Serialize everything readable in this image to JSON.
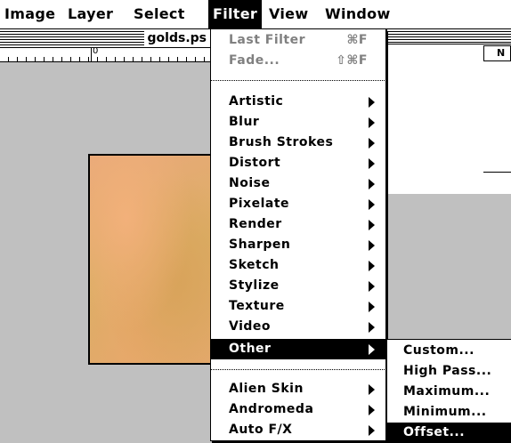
{
  "menubar": {
    "items": [
      {
        "label": "Image"
      },
      {
        "label": "Layer"
      },
      {
        "label": "Select"
      },
      {
        "label": "Filter",
        "active": true
      },
      {
        "label": "View"
      },
      {
        "label": "Window"
      }
    ]
  },
  "document": {
    "title": "golds.ps",
    "ruler_zero": "0"
  },
  "palette": {
    "tab_label": "N"
  },
  "filter_menu": {
    "top_items": [
      {
        "label": "Last Filter",
        "shortcut": "⌘F",
        "enabled": false
      },
      {
        "label": "Fade...",
        "shortcut": "⇧⌘F",
        "enabled": false
      }
    ],
    "filter_groups": [
      {
        "label": "Artistic"
      },
      {
        "label": "Blur"
      },
      {
        "label": "Brush Strokes"
      },
      {
        "label": "Distort"
      },
      {
        "label": "Noise"
      },
      {
        "label": "Pixelate"
      },
      {
        "label": "Render"
      },
      {
        "label": "Sharpen"
      },
      {
        "label": "Sketch"
      },
      {
        "label": "Stylize"
      },
      {
        "label": "Texture"
      },
      {
        "label": "Video"
      },
      {
        "label": "Other",
        "highlighted": true
      }
    ],
    "plugin_groups": [
      {
        "label": "Alien Skin"
      },
      {
        "label": "Andromeda"
      },
      {
        "label": "Auto F/X"
      }
    ]
  },
  "other_submenu": {
    "items": [
      {
        "label": "Custom..."
      },
      {
        "label": "High Pass..."
      },
      {
        "label": "Maximum..."
      },
      {
        "label": "Minimum..."
      },
      {
        "label": "Offset...",
        "highlighted": true
      }
    ]
  },
  "colors": {
    "desktop": "#c0c0c0",
    "highlight": "#000000",
    "disabled_text": "#808080"
  }
}
